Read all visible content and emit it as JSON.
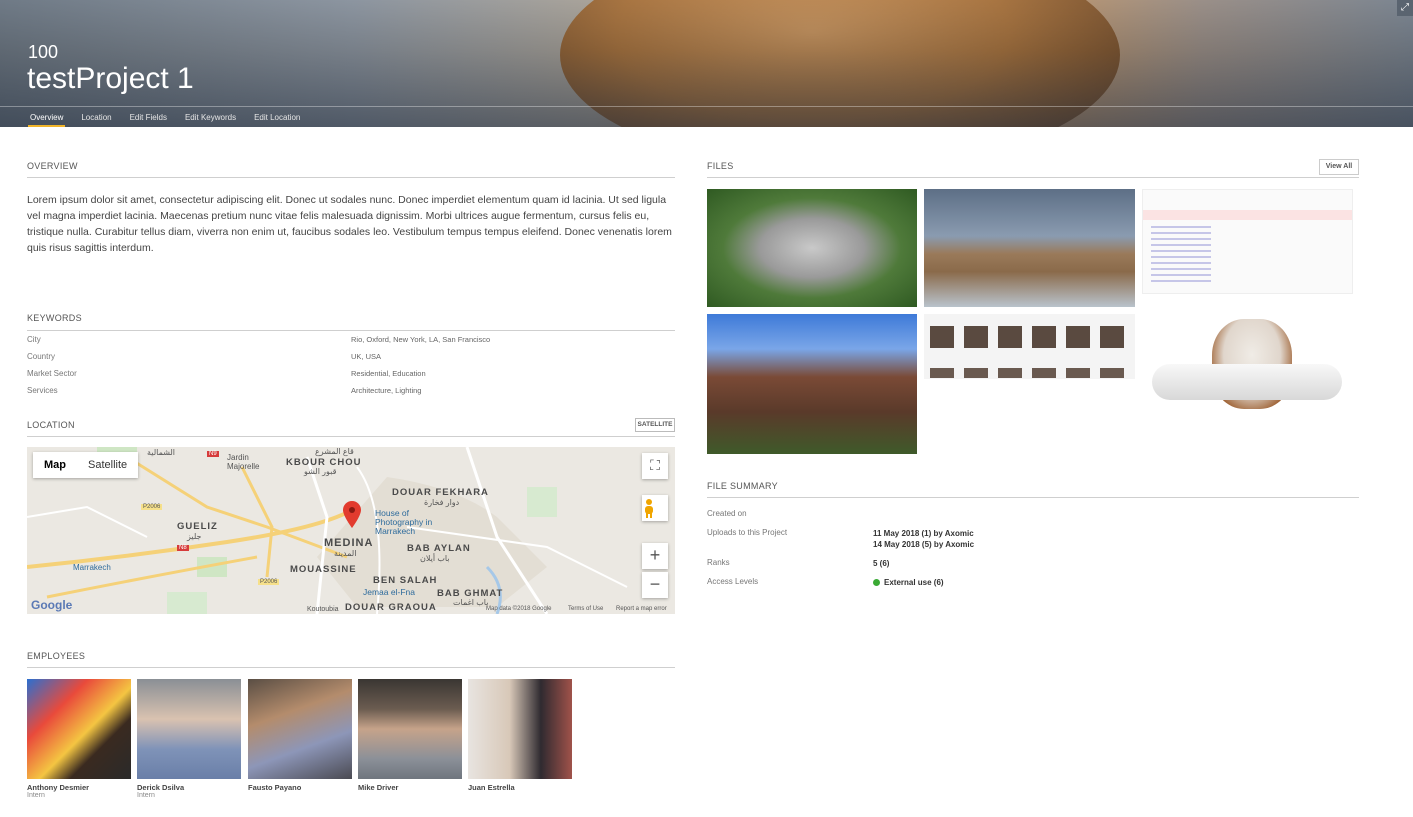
{
  "header": {
    "project_id": "100",
    "project_title": "testProject 1",
    "tabs": [
      "Overview",
      "Location",
      "Edit Fields",
      "Edit Keywords",
      "Edit Location"
    ],
    "active_tab": "Overview",
    "expand_icon": "expand-icon"
  },
  "overview": {
    "title": "OVERVIEW",
    "text": "Lorem ipsum dolor sit amet, consectetur adipiscing elit. Donec ut sodales nunc. Donec imperdiet elementum quam id lacinia. Ut sed ligula vel magna imperdiet lacinia. Maecenas pretium nunc vitae felis malesuada dignissim. Morbi ultrices augue fermentum, cursus felis eu, tristique nulla. Curabitur tellus diam, viverra non enim ut, faucibus sodales leo. Vestibulum tempus tempus eleifend. Donec venenatis lorem quis risus sagittis interdum."
  },
  "keywords": {
    "title": "KEYWORDS",
    "rows": [
      {
        "key": "City",
        "value": "Rio, Oxford, New York, LA, San Francisco"
      },
      {
        "key": "Country",
        "value": "UK, USA"
      },
      {
        "key": "Market Sector",
        "value": "Residential, Education"
      },
      {
        "key": "Services",
        "value": "Architecture, Lighting"
      }
    ]
  },
  "location": {
    "title": "LOCATION",
    "satellite_button": "SATELLITE",
    "map": {
      "toggle_map": "Map",
      "toggle_satellite": "Satellite",
      "labels": {
        "kbour": "KBOUR CHOU",
        "kbour_ar": "قبور الشو",
        "douar_fekhara": "DOUAR FEKHARA",
        "douar_fekhara_ar": "دوار فخارة",
        "gueliz": "GUELIZ",
        "gueliz_ar": "جليز",
        "medina": "MEDINA",
        "medina_ar": "المدينة",
        "bab_aylan": "BAB AYLAN",
        "bab_aylan_ar": "باب أيلان",
        "mouassine": "MOUASSINE",
        "ben_salah": "BEN SALAH",
        "bab_ghmat": "BAB GHMAT",
        "bab_ghmat_ar": "باب اغمات",
        "douar_graoua": "DOUAR GRAOUA",
        "jardin": "Jardin Majorelle",
        "house_photo": "House of Photography in Marrakech",
        "jemaa": "Jemaa el-Fna",
        "marrakech": "Marrakech",
        "koutoubia": "Koutoubia",
        "shamalia": "الشمالية",
        "machrouaa": "قاع المشرع",
        "p2006a": "P2006",
        "p2006b": "P2006",
        "n8": "N8",
        "n9": "N9"
      },
      "footer": {
        "google": "Google",
        "data": "Map data ©2018 Google",
        "terms": "Terms of Use",
        "report": "Report a map error"
      }
    }
  },
  "employees": {
    "title": "EMPLOYEES",
    "people": [
      {
        "name": "Anthony Desmier",
        "role": "Intern"
      },
      {
        "name": "Derick Dsilva",
        "role": "Intern"
      },
      {
        "name": "Fausto Payano",
        "role": ""
      },
      {
        "name": "Mike Driver",
        "role": ""
      },
      {
        "name": "Juan Estrella",
        "role": ""
      }
    ]
  },
  "files": {
    "title": "FILES",
    "view_all": "View All"
  },
  "file_summary": {
    "title": "FILE SUMMARY",
    "created_on_label": "Created on",
    "uploads_label": "Uploads to this Project",
    "uploads": [
      "11 May 2018 (1) by Axomic",
      "14 May 2018 (5) by Axomic"
    ],
    "ranks_label": "Ranks",
    "ranks": "5 (6)",
    "access_label": "Access Levels",
    "access": "External use (6)",
    "access_color": "#3aaa35"
  }
}
